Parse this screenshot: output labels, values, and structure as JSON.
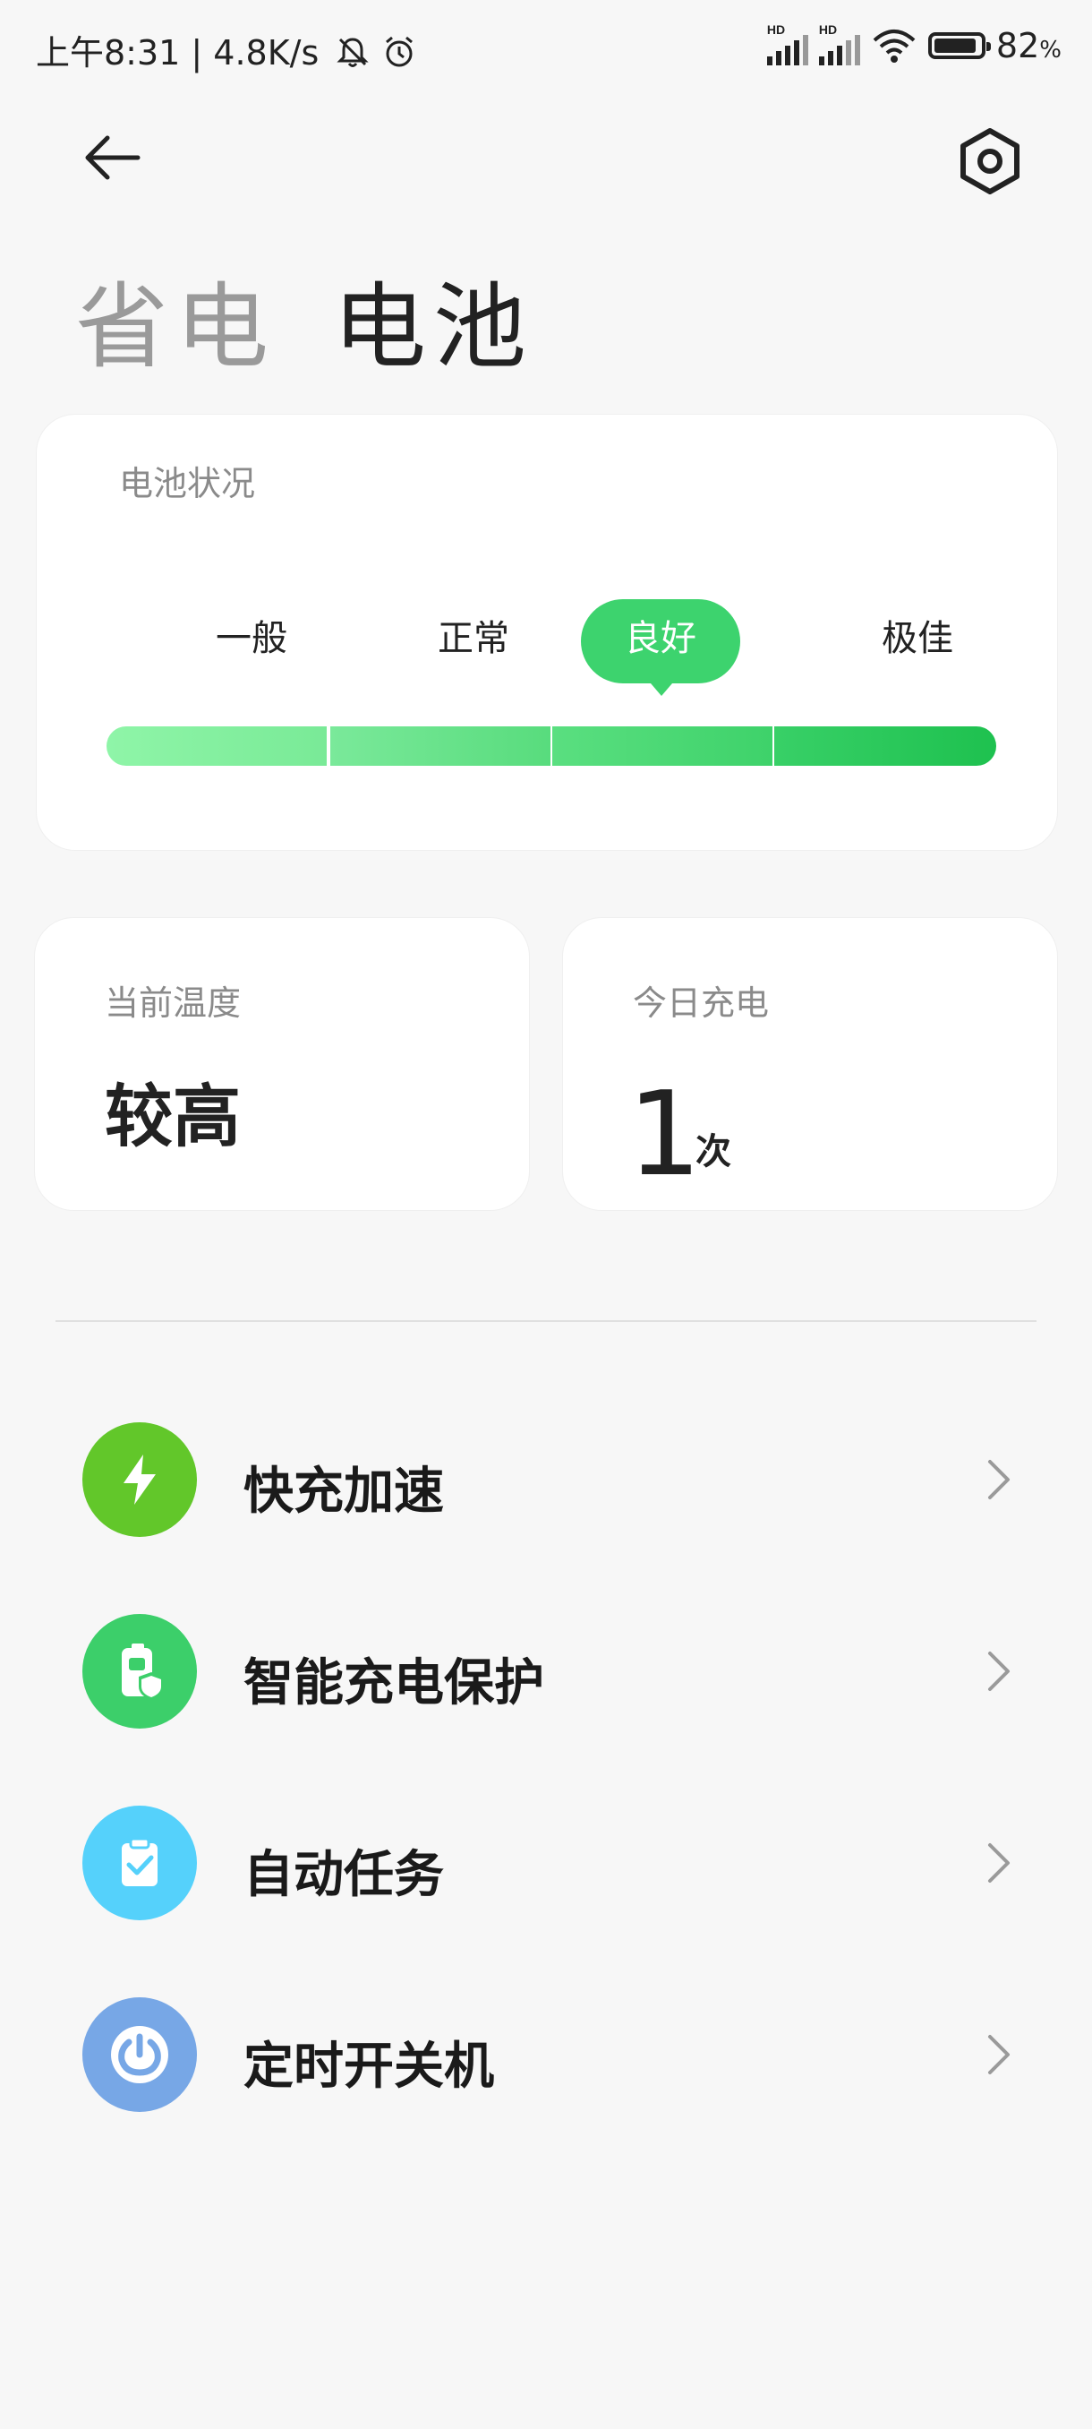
{
  "status_bar": {
    "time_speed": "上午8:31 | 4.8K/s",
    "hd1": "HD",
    "hd2": "HD",
    "battery_percent": "82",
    "percent_sign": "%"
  },
  "header": {
    "icons": {
      "back": "back-arrow-icon",
      "settings": "settings-icon"
    },
    "tabs": [
      {
        "label": "省电",
        "active": false
      },
      {
        "label": "电池",
        "active": true
      }
    ]
  },
  "battery_status": {
    "title": "电池状况",
    "levels": [
      "一般",
      "正常",
      "良好",
      "极佳"
    ],
    "selected_level": "良好"
  },
  "temperature": {
    "label": "当前温度",
    "value": "较高"
  },
  "charge_today": {
    "label": "今日充电",
    "count": "1",
    "unit": "次"
  },
  "menu": [
    {
      "label": "快充加速",
      "icon": "lightning-icon",
      "color": "#62c72a"
    },
    {
      "label": "智能充电保护",
      "icon": "battery-shield-icon",
      "color": "#3ccf6a"
    },
    {
      "label": "自动任务",
      "icon": "clipboard-check-icon",
      "color": "#55d1fb"
    },
    {
      "label": "定时开关机",
      "icon": "power-icon",
      "color": "#77a7e6"
    }
  ],
  "colors": {
    "accent_green": "#3dd36e",
    "background": "#f7f7f7"
  }
}
